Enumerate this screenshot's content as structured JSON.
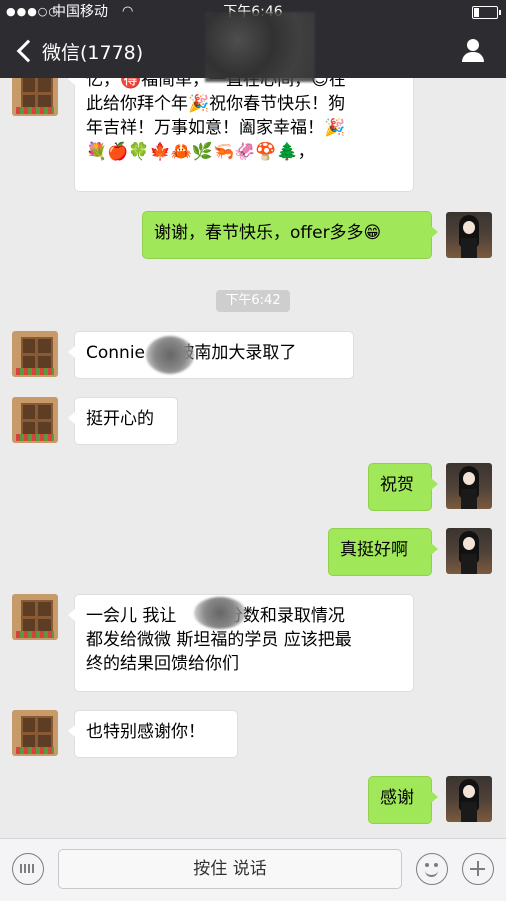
{
  "status_bar": {
    "signal": "●●●○○",
    "carrier": "中国移动",
    "wifi_icon": "wifi-icon",
    "time": "下午6:46"
  },
  "nav": {
    "back_label": "微信(1778)",
    "contact_icon": "person-icon"
  },
  "messages": [
    {
      "side": "left",
      "text": "忆，🉐福简单，一直在心间，😊在\n此给你拜个年🎉祝你春节快乐！狗\n年吉祥！万事如意！阖家幸福！🎉\n💐🍎🍀🍁🦀🌿🦐🦑🍄🌲，"
    },
    {
      "side": "right",
      "text": "谢谢，春节快乐，offer多多😁"
    },
    {
      "side": "left",
      "text": "Connie      被南加大录取了"
    },
    {
      "side": "left",
      "text": "挺开心的"
    },
    {
      "side": "right",
      "text": "祝贺"
    },
    {
      "side": "right",
      "text": "真挺好啊"
    },
    {
      "side": "left",
      "text": "一会儿 我让      把分数和录取情况\n都发给微微 斯坦福的学员 应该把最\n终的结果回馈给你们"
    },
    {
      "side": "left",
      "text": "也特别感谢你！"
    },
    {
      "side": "right",
      "text": "感谢"
    }
  ],
  "timestamp": "下午6:42",
  "input_bar": {
    "keyboard_icon": "keyboard-icon",
    "hold_to_talk": "按住 说话",
    "emoji_icon": "emoji-icon",
    "plus_icon": "plus-icon"
  }
}
